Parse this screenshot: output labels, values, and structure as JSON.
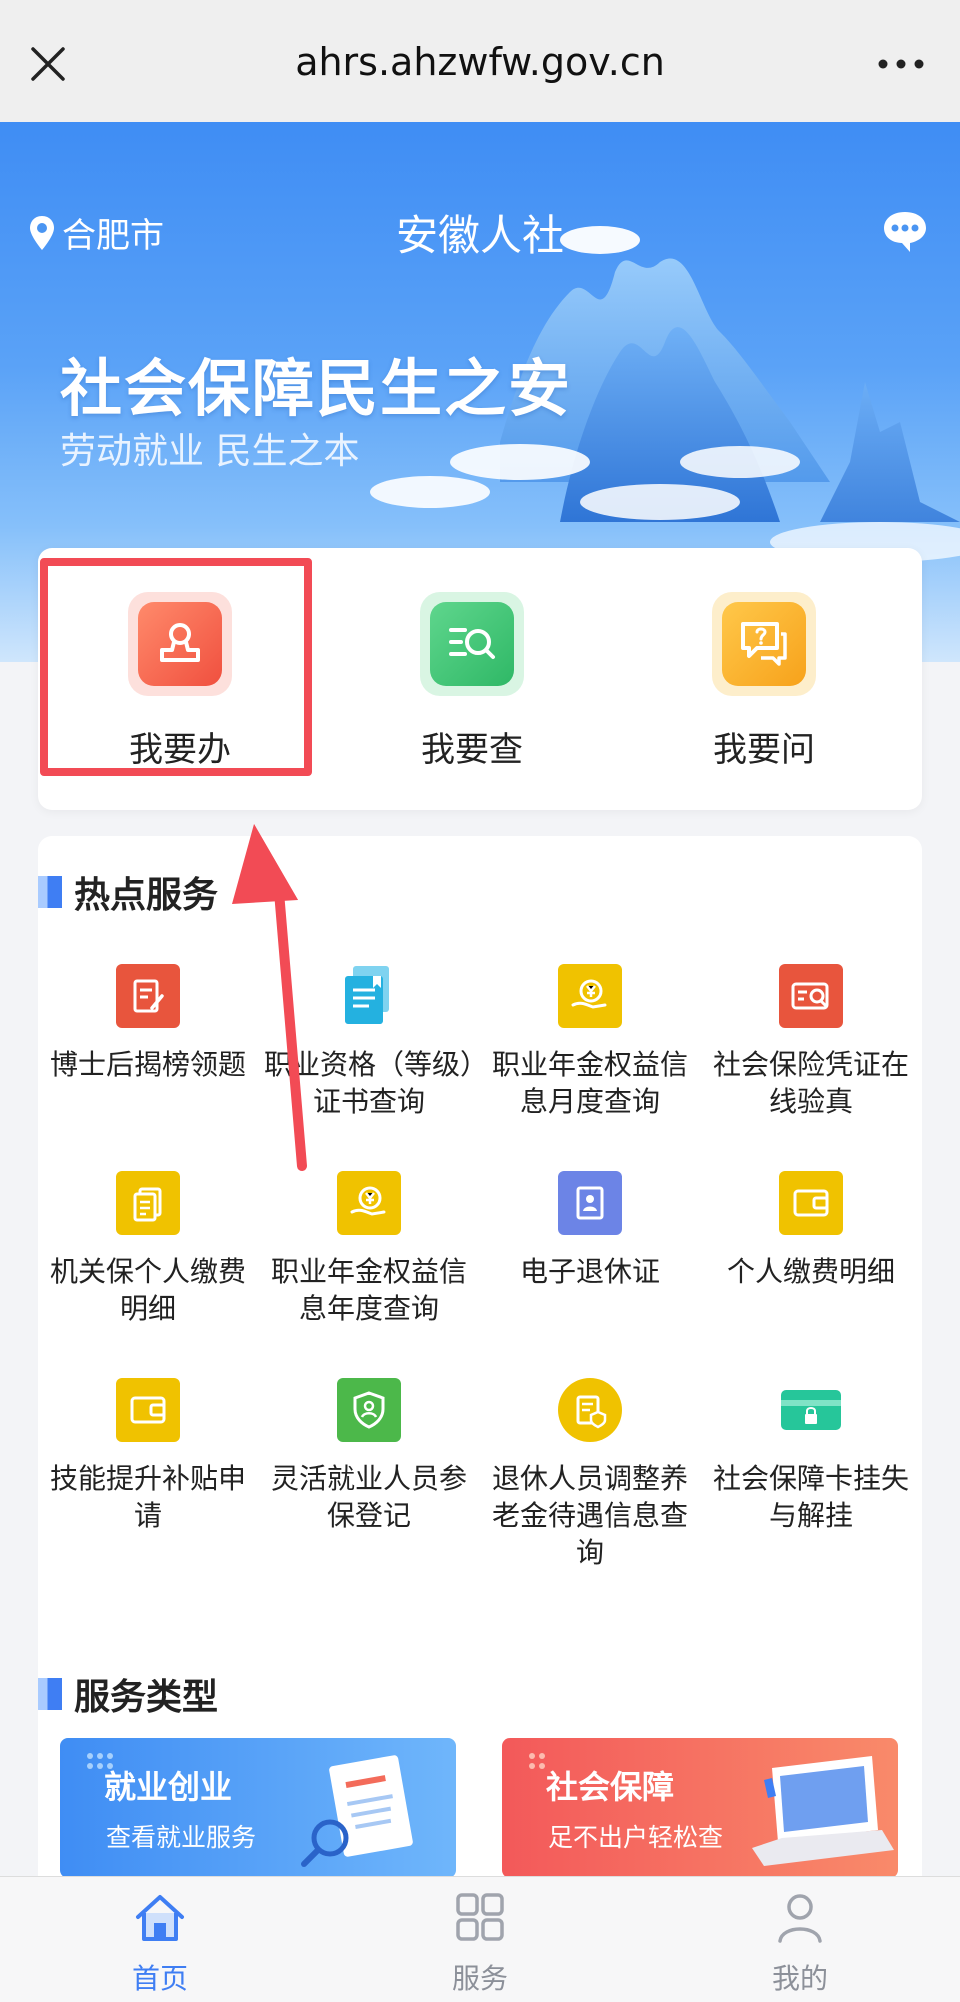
{
  "browser": {
    "url": "ahrs.ahzwfw.gov.cn",
    "close_icon": "close-icon",
    "more_icon": "more-icon"
  },
  "header": {
    "city": "合肥市",
    "title": "安徽人社",
    "location_icon": "location-pin-icon",
    "message_icon": "chat-bubble-icon"
  },
  "hero": {
    "slogan": "社会保障民生之安",
    "subslogan": "劳动就业 民生之本"
  },
  "quick_actions": [
    {
      "label": "我要办",
      "icon": "stamp-icon",
      "color": "#f2614f"
    },
    {
      "label": "我要查",
      "icon": "search-list-icon",
      "color": "#3fc274"
    },
    {
      "label": "我要问",
      "icon": "question-chat-icon",
      "color": "#f5a623"
    }
  ],
  "hot_services": {
    "title": "热点服务",
    "items": [
      {
        "label": "博士后揭榜领题",
        "icon": "edit-document-icon",
        "color": "#e8553d"
      },
      {
        "label": "职业资格（等级）证书查询",
        "icon": "certificate-icon",
        "color": "#2bb7e4"
      },
      {
        "label": "职业年金权益信息月度查询",
        "icon": "pension-coin-icon",
        "color": "#f0c200"
      },
      {
        "label": "社会保险凭证在线验真",
        "icon": "verify-card-icon",
        "color": "#e8553d"
      },
      {
        "label": "机关保个人缴费明细",
        "icon": "document-list-icon",
        "color": "#f0c200"
      },
      {
        "label": "职业年金权益信息年度查询",
        "icon": "pension-coin-icon",
        "color": "#f0c200"
      },
      {
        "label": "电子退休证",
        "icon": "id-card-icon",
        "color": "#6c84e6"
      },
      {
        "label": "个人缴费明细",
        "icon": "wallet-icon",
        "color": "#f0c200"
      },
      {
        "label": "技能提升补贴申请",
        "icon": "wallet-icon",
        "color": "#f0c200"
      },
      {
        "label": "灵活就业人员参保登记",
        "icon": "shield-user-icon",
        "color": "#4cb84a"
      },
      {
        "label": "退休人员调整养老金待遇信息查询",
        "icon": "shield-document-icon",
        "color": "#f0c200"
      },
      {
        "label": "社会保障卡挂失与解挂",
        "icon": "lock-card-icon",
        "color": "#26c69a"
      }
    ]
  },
  "service_types": {
    "title": "服务类型",
    "banners": [
      {
        "title": "就业创业",
        "subtitle": "查看就业服务",
        "color": "#3f8df4"
      },
      {
        "title": "社会保障",
        "subtitle": "足不出户轻松查",
        "color": "#f36b5a"
      }
    ]
  },
  "bottom_nav": [
    {
      "label": "首页",
      "icon": "home-icon",
      "active": true
    },
    {
      "label": "服务",
      "icon": "grid-icon",
      "active": false
    },
    {
      "label": "我的",
      "icon": "user-icon",
      "active": false
    }
  ],
  "colors": {
    "brand": "#3f7ef3",
    "highlight": "#f24b55"
  }
}
